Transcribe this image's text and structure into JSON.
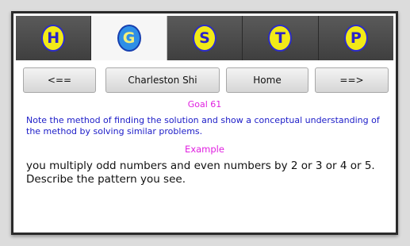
{
  "tabs": [
    {
      "letter": "H"
    },
    {
      "letter": "G"
    },
    {
      "letter": "S"
    },
    {
      "letter": "T"
    },
    {
      "letter": "P"
    }
  ],
  "nav": {
    "prev_label": "<==",
    "name_label": "Charleston Shi",
    "home_label": "Home",
    "next_label": "==>"
  },
  "content": {
    "goal": "Goal 61",
    "note": "Note the method of finding the solution and show a conceptual understanding of the method by solving similar problems.",
    "example_heading": "Example",
    "example_text": "you multiply odd numbers and even numbers by 2 or 3 or 4 or 5. Describe the pattern you see."
  },
  "colors": {
    "badge_fill": "#f2ea17",
    "badge_active_fill": "#2f8fe6",
    "badge_letter": "#2b24c8",
    "heading_magenta": "#e020e0",
    "note_blue": "#1c1cc8"
  }
}
